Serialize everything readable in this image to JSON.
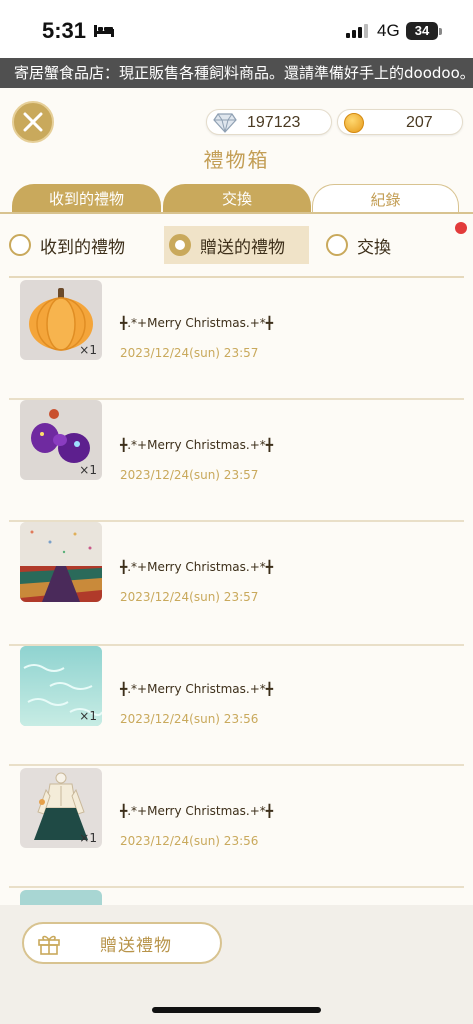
{
  "status_bar": {
    "time": "5:31",
    "network": "4G",
    "battery": "34"
  },
  "marquee": {
    "text": "寄居蟹食品店：現正販售各種飼料商品。還請準備好手上的doodoo。"
  },
  "header": {
    "gem_count": "197123",
    "coin_count": "207",
    "title": "禮物箱"
  },
  "tabs": [
    {
      "label": "收到的禮物"
    },
    {
      "label": "交換"
    },
    {
      "label": "紀錄"
    }
  ],
  "filters": [
    {
      "label": "收到的禮物",
      "selected": false
    },
    {
      "label": "贈送的禮物",
      "selected": true
    },
    {
      "label": "交換",
      "selected": false
    }
  ],
  "gifts": [
    {
      "item": "pumpkin",
      "qty": "×1",
      "message": "╋.*+Merry Christmas.+*╋",
      "time": "2023/12/24(sun) 23:57"
    },
    {
      "item": "purple-flower",
      "qty": "×1",
      "message": "╋.*+Merry Christmas.+*╋",
      "time": "2023/12/24(sun) 23:57"
    },
    {
      "item": "starry-landscape",
      "qty": "",
      "message": "╋.*+Merry Christmas.+*╋",
      "time": "2023/12/24(sun) 23:57"
    },
    {
      "item": "sea-water",
      "qty": "×1",
      "message": "╋.*+Merry Christmas.+*╋",
      "time": "2023/12/24(sun) 23:56"
    },
    {
      "item": "dress",
      "qty": "×1",
      "message": "╋.*+Merry Christmas.+*╋",
      "time": "2023/12/24(sun) 23:56"
    }
  ],
  "bottom": {
    "send_label": "贈送禮物"
  },
  "colors": {
    "gold": "#c9a95c",
    "marquee_bg": "#505050",
    "badge": "#e23b3b"
  }
}
